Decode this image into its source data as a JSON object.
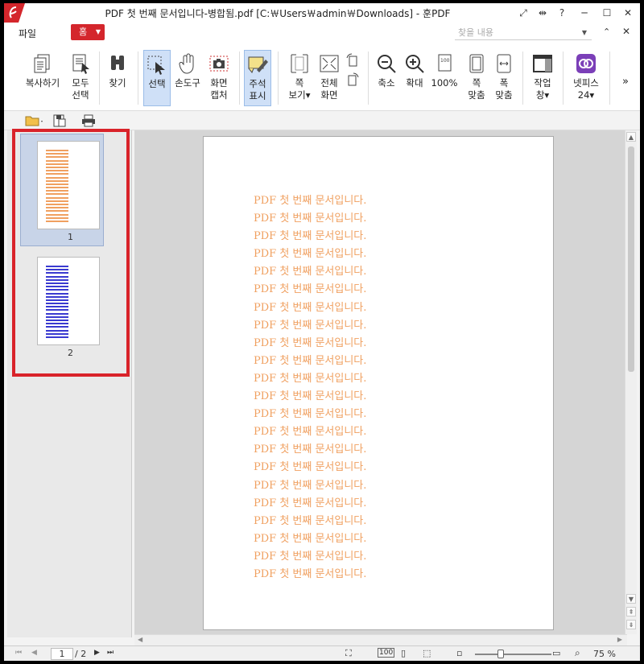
{
  "titlebar": {
    "title": "PDF 첫 번째 문서입니다-병합됨.pdf [C:￦Users￦admin￦Downloads] - 훈PDF",
    "controls": [
      "⤢",
      "⇹",
      "?",
      "─",
      "☐",
      "✕"
    ]
  },
  "menubar": {
    "file": "파일",
    "home_tab": "홈",
    "search_placeholder": "찾을 내용",
    "collapse": "⌃",
    "close": "✕"
  },
  "ribbon": {
    "copy": "복사하기",
    "select_all_1": "모두",
    "select_all_2": "선택",
    "find": "찾기",
    "select": "선택",
    "hand": "손도구",
    "capture_1": "화면",
    "capture_2": "캡처",
    "annot_1": "주석",
    "annot_2": "표시",
    "pageview_1": "쪽",
    "pageview_2": "보기▾",
    "full_1": "전체",
    "full_2": "화면",
    "zoom_out": "축소",
    "zoom_in": "확대",
    "zoom_100": "100%",
    "fit_page_1": "쪽",
    "fit_page_2": "맞춤",
    "fit_width_1": "폭",
    "fit_width_2": "맞춤",
    "window_1": "작업",
    "window_2": "창▾",
    "netpis_1": "넷피스",
    "netpis_2": "24▾",
    "more": "»"
  },
  "thumbnails": [
    {
      "label": "1",
      "color": "#f0a060",
      "selected": true
    },
    {
      "label": "2",
      "color": "#3a3ad0",
      "selected": false
    }
  ],
  "document": {
    "lines": [
      "PDF 첫 번째 문서입니다.",
      "PDF 첫 번째 문서입니다.",
      "PDF 첫 번째 문서입니다.",
      "PDF 첫 번째 문서입니다.",
      "PDF 첫 번째 문서입니다.",
      "PDF 첫 번째 문서입니다.",
      "PDF 첫 번째 문서입니다.",
      "PDF 첫 번째 문서입니다.",
      "PDF 첫 번째 문서입니다.",
      "PDF 첫 번째 문서입니다.",
      "PDF 첫 번째 문서입니다.",
      "PDF 첫 번째 문서입니다.",
      "PDF 첫 번째 문서입니다.",
      "PDF 첫 번째 문서입니다.",
      "PDF 첫 번째 문서입니다.",
      "PDF 첫 번째 문서입니다.",
      "PDF 첫 번째 문서입니다.",
      "PDF 첫 번째 문서입니다.",
      "PDF 첫 번째 문서입니다.",
      "PDF 첫 번째 문서입니다.",
      "PDF 첫 번째 문서입니다.",
      "PDF 첫 번째 문서입니다."
    ],
    "text_color": "#f0a060"
  },
  "statusbar": {
    "current_page": "1",
    "total_pages": "/ 2",
    "zoom": "75 %"
  },
  "colors": {
    "accent": "#d4262c",
    "highlight": "#d9232a"
  }
}
